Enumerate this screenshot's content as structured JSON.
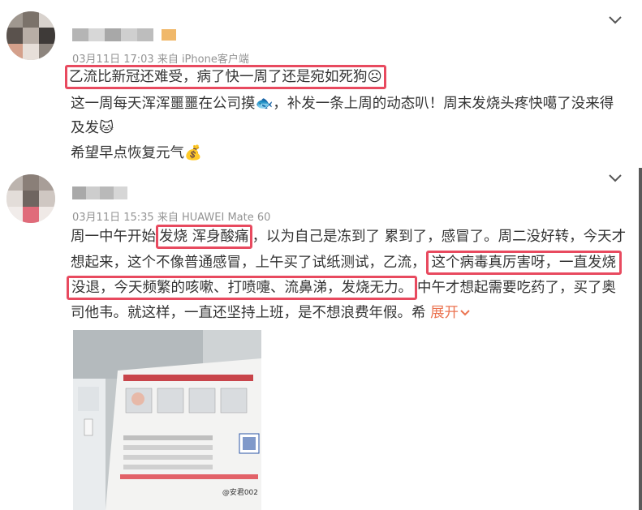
{
  "posts": [
    {
      "meta": "03月11日 17:03  来自 iPhone客户端",
      "lines": [
        "乙流比新冠还难受，病了快一周了还是宛如死狗☹",
        "这一周每天浑浑噩噩在公司摸🐟，补发一条上周的动态叭！周末发烧头疼快噶了没来得",
        "及发🐱",
        "希望早点恢复元气💰"
      ]
    },
    {
      "meta": "03月11日 15:35  来自 HUAWEI Mate 60",
      "l1a": "周一中午开始",
      "l1b": "发烧 浑身酸痛",
      "l1c": "，以为自己是冻到了 累到了，感冒了。周二没好转，今天才",
      "l2a": "想起来，这个不像普通感冒，上午买了试纸测试，乙流，",
      "l2b": "这个病毒真厉害呀，一直发烧",
      "l3a": "没退，今天频繁的咳嗽、打喷嚏、流鼻涕，发烧无力。",
      "l3b": "中午才想起需要吃药了，买了奥",
      "l4": "司他韦。就这样，一直还坚持上班，是不想浪费年假。希 ",
      "expand": "展开",
      "photo_watermark": "@安君002"
    }
  ],
  "colors": {
    "highlight": "#e84a5f",
    "expand": "#eb7350"
  }
}
